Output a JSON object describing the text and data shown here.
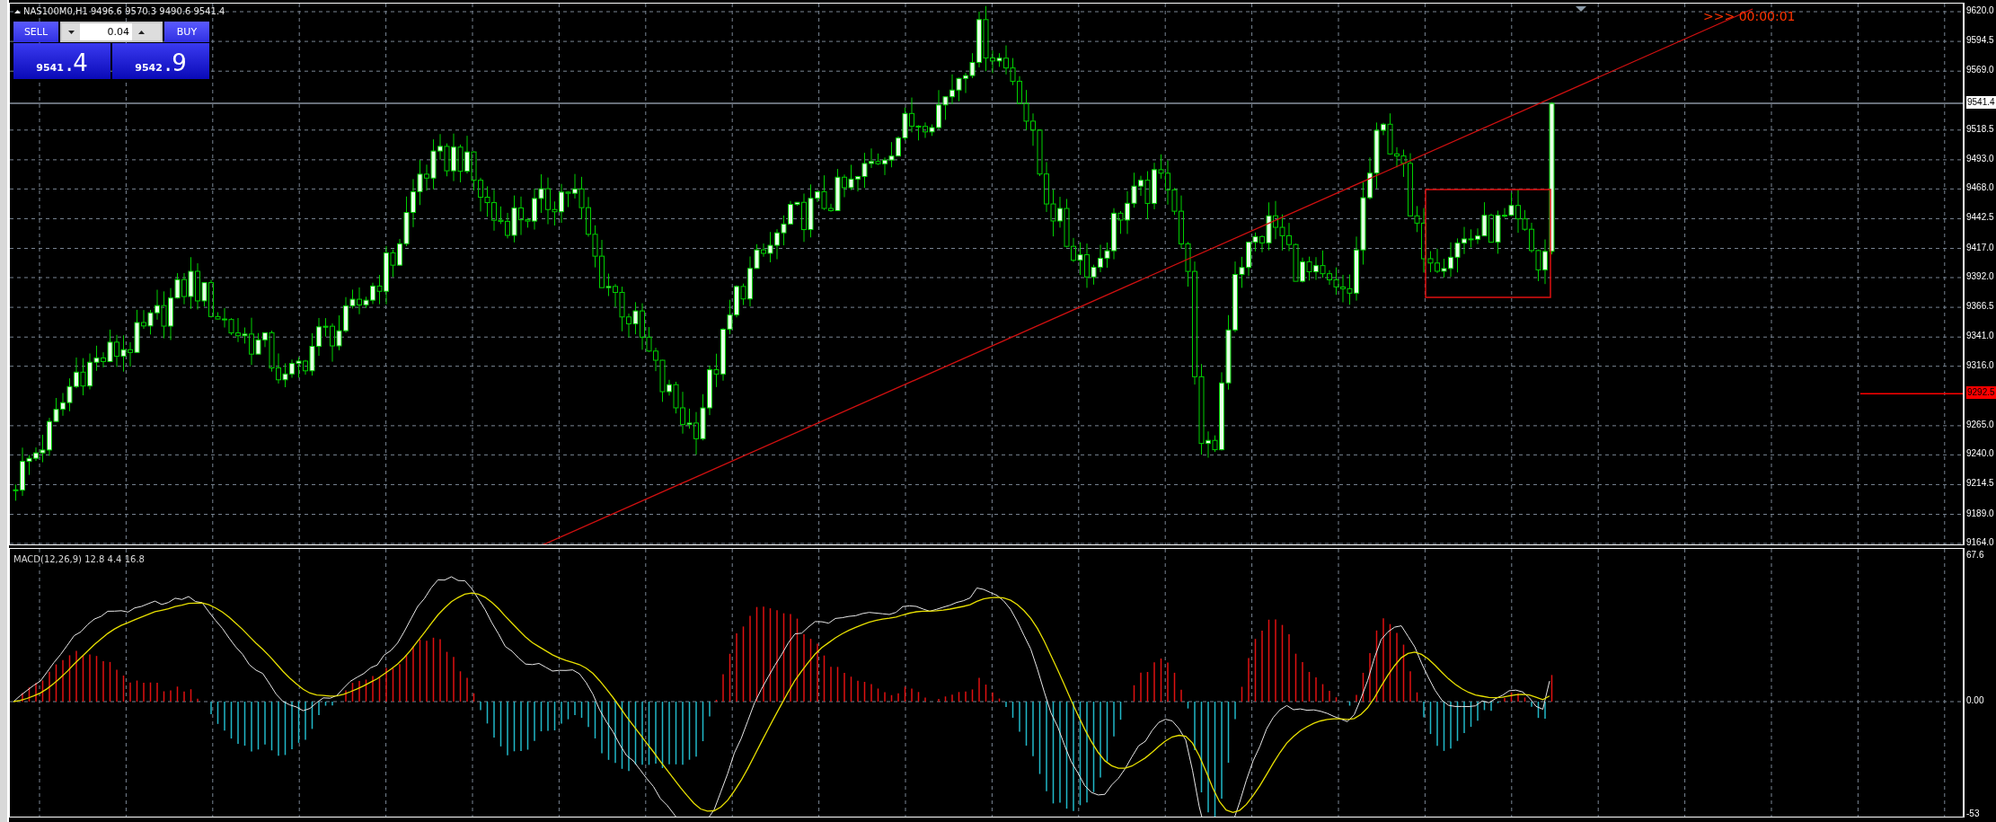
{
  "chart_title": "NAS100M0,H1  9496.6 9570.3 9490.6 9541.4",
  "trade_panel": {
    "sell_label": "SELL",
    "buy_label": "BUY",
    "lot": "0.04",
    "sell_price_main": "9541",
    "sell_price_frac": ".4",
    "buy_price_main": "9542",
    "buy_price_frac": ".9"
  },
  "countdown": ">>> 00:00:01",
  "price_axis": [
    {
      "label": "9620.0"
    },
    {
      "label": "9594.5"
    },
    {
      "label": "9569.0"
    },
    {
      "label": "9518.5"
    },
    {
      "label": "9493.0"
    },
    {
      "label": "9468.0"
    },
    {
      "label": "9442.5"
    },
    {
      "label": "9417.0"
    },
    {
      "label": "9392.0"
    },
    {
      "label": "9366.5"
    },
    {
      "label": "9341.0"
    },
    {
      "label": "9316.0"
    },
    {
      "label": "9265.0"
    },
    {
      "label": "9240.0"
    },
    {
      "label": "9214.5"
    },
    {
      "label": "9189.0"
    },
    {
      "label": "9164.0"
    }
  ],
  "bid_label": "9541.4",
  "alert_label": "9292.5",
  "macd": {
    "label": "MACD(12,26,9) 12.8 4.4 16.8",
    "axis": [
      {
        "label": "67.6"
      },
      {
        "label": "0.00"
      },
      {
        "label": "-53"
      }
    ]
  }
}
